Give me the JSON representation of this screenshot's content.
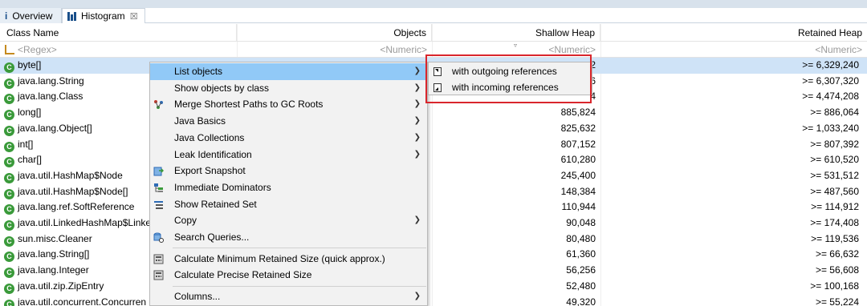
{
  "tabs": [
    {
      "label": "Overview",
      "icon": "info-icon"
    },
    {
      "label": "Histogram",
      "icon": "histogram-icon",
      "close": "☒"
    }
  ],
  "columns": {
    "class_name": "Class Name",
    "objects": "Objects",
    "shallow_heap": "Shallow Heap",
    "retained_heap": "Retained Heap"
  },
  "filters": {
    "class_name": "<Regex>",
    "objects": "<Numeric>",
    "shallow_heap": "<Numeric>",
    "retained_heap": "<Numeric>"
  },
  "rows": [
    {
      "name": "byte[]",
      "objects": "",
      "shallow": "2",
      "retained": ">= 6,329,240",
      "selected": true
    },
    {
      "name": "java.lang.String",
      "objects": "",
      "shallow": "6",
      "retained": ">= 6,307,320"
    },
    {
      "name": "java.lang.Class",
      "objects": "",
      "shallow": "4",
      "retained": ">= 4,474,208"
    },
    {
      "name": "long[]",
      "objects": "",
      "shallow": "885,824",
      "retained": ">= 886,064"
    },
    {
      "name": "java.lang.Object[]",
      "objects": "",
      "shallow": "825,632",
      "retained": ">= 1,033,240"
    },
    {
      "name": "int[]",
      "objects": "",
      "shallow": "807,152",
      "retained": ">= 807,392"
    },
    {
      "name": "char[]",
      "objects": "",
      "shallow": "610,280",
      "retained": ">= 610,520"
    },
    {
      "name": "java.util.HashMap$Node",
      "objects": "",
      "shallow": "245,400",
      "retained": ">= 531,512"
    },
    {
      "name": "java.util.HashMap$Node[]",
      "objects": "",
      "shallow": "148,384",
      "retained": ">= 487,560"
    },
    {
      "name": "java.lang.ref.SoftReference",
      "objects": "",
      "shallow": "110,944",
      "retained": ">= 114,912"
    },
    {
      "name": "java.util.LinkedHashMap$Linke",
      "objects": "",
      "shallow": "90,048",
      "retained": ">= 174,408"
    },
    {
      "name": "sun.misc.Cleaner",
      "objects": "",
      "shallow": "80,480",
      "retained": ">= 119,536"
    },
    {
      "name": "java.lang.String[]",
      "objects": "",
      "shallow": "61,360",
      "retained": ">= 66,632"
    },
    {
      "name": "java.lang.Integer",
      "objects": "",
      "shallow": "56,256",
      "retained": ">= 56,608"
    },
    {
      "name": "java.util.zip.ZipEntry",
      "objects": "",
      "shallow": "52,480",
      "retained": ">= 100,168"
    },
    {
      "name": "java.util.concurrent.Concurren",
      "objects": "",
      "shallow": "49,320",
      "retained": ">= 55,224"
    }
  ],
  "menu": [
    {
      "label": "List objects",
      "submenu": true,
      "active": true,
      "icon": ""
    },
    {
      "label": "Show objects by class",
      "submenu": true,
      "icon": ""
    },
    {
      "label": "Merge Shortest Paths to GC Roots",
      "submenu": true,
      "icon": "gc-roots-icon"
    },
    {
      "label": "Java Basics",
      "submenu": true,
      "icon": ""
    },
    {
      "label": "Java Collections",
      "submenu": true,
      "icon": ""
    },
    {
      "label": "Leak Identification",
      "submenu": true,
      "icon": ""
    },
    {
      "label": "Export Snapshot",
      "submenu": false,
      "icon": "export-icon"
    },
    {
      "label": "Immediate Dominators",
      "submenu": false,
      "icon": "dominators-icon"
    },
    {
      "label": "Show Retained Set",
      "submenu": false,
      "icon": "retained-set-icon"
    },
    {
      "label": "Copy",
      "submenu": true,
      "icon": ""
    },
    {
      "label": "Search Queries...",
      "submenu": false,
      "icon": "search-queries-icon"
    },
    {
      "label": "Calculate Minimum Retained Size (quick approx.)",
      "submenu": false,
      "icon": "calculator-icon"
    },
    {
      "label": "Calculate Precise Retained Size",
      "submenu": false,
      "icon": "calculator-icon"
    },
    {
      "label": "Columns...",
      "submenu": true,
      "icon": ""
    }
  ],
  "submenu": [
    {
      "label": "with outgoing references",
      "icon": "outgoing-references-icon"
    },
    {
      "label": "with incoming references",
      "icon": "incoming-references-icon"
    }
  ],
  "colors": {
    "accent": "#91c9f7",
    "selected_row": "#cfe3f7",
    "highlight_box": "#d9262c",
    "class_icon": "#3a9a3a"
  }
}
